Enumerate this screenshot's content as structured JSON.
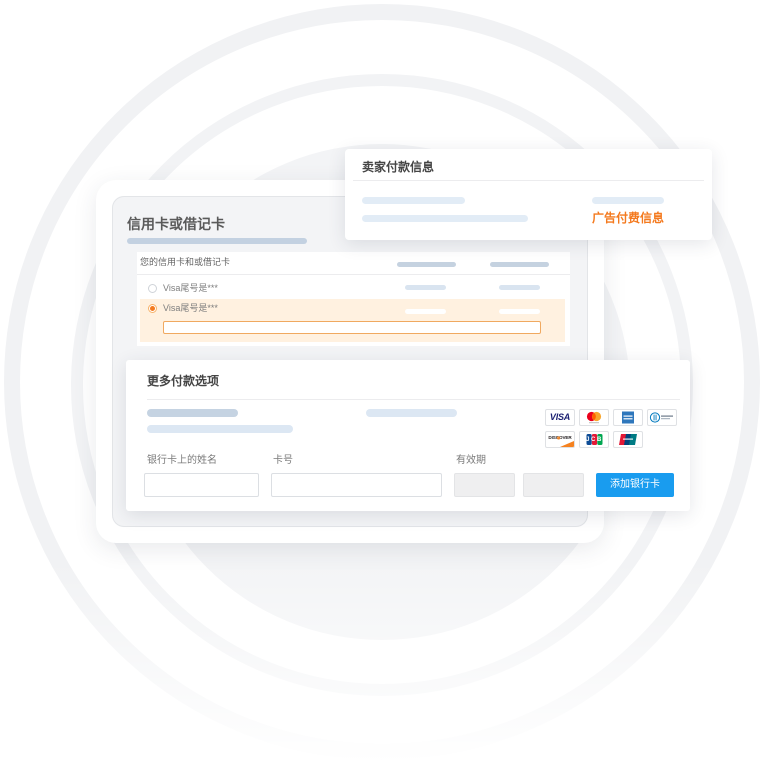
{
  "colors": {
    "accent": "#f47a1f",
    "primary": "#199cef",
    "highlight_row": "#fff1e0"
  },
  "seller_payment": {
    "title": "卖家付款信息",
    "ad_billing_link": "广告付费信息"
  },
  "card_panel": {
    "title": "信用卡或借记卡",
    "table_header": "您的信用卡和或借记卡",
    "rows": [
      {
        "label": "Visa尾号是***",
        "selected": false
      },
      {
        "label": "Visa尾号是***",
        "selected": true
      }
    ]
  },
  "more_options": {
    "title": "更多付款选项",
    "card_brands": [
      {
        "icon": "visa-logo",
        "text": "VISA"
      },
      {
        "icon": "mastercard-logo"
      },
      {
        "icon": "amex-logo"
      },
      {
        "icon": "diners-club-logo"
      },
      {
        "icon": "discover-logo",
        "text": "DISCOVER"
      },
      {
        "icon": "jcb-logo",
        "text": "JCB"
      },
      {
        "icon": "unionpay-logo"
      }
    ],
    "fields": {
      "name_label": "银行卡上的姓名",
      "number_label": "卡号",
      "expiry_label": "有效期"
    },
    "add_button_label": "添加银行卡"
  }
}
